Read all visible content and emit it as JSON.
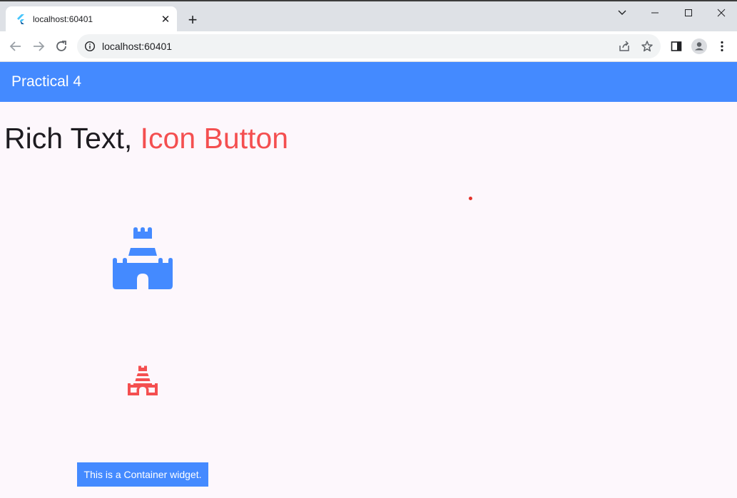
{
  "browser": {
    "tab_title": "localhost:60401",
    "url": "localhost:60401",
    "icons": [
      "flutter-favicon",
      "close-icon",
      "plus-icon",
      "chevron-down-icon",
      "minimize-icon",
      "maximize-icon",
      "window-close-icon",
      "back-arrow-icon",
      "forward-arrow-icon",
      "reload-icon",
      "info-icon",
      "share-icon",
      "star-icon",
      "side-panel-icon",
      "profile-icon",
      "more-vert-icon"
    ]
  },
  "app": {
    "title": "Practical 4",
    "rich_text": {
      "part1": "Rich Text, ",
      "part2": "Icon Button"
    },
    "icons": [
      "castle-icon",
      "castle-outline-icon"
    ],
    "container_text": "This is a Container widget.",
    "colors": {
      "primary": "#448aff",
      "accent_red": "#f44f50",
      "background": "#fdf7fc"
    }
  }
}
